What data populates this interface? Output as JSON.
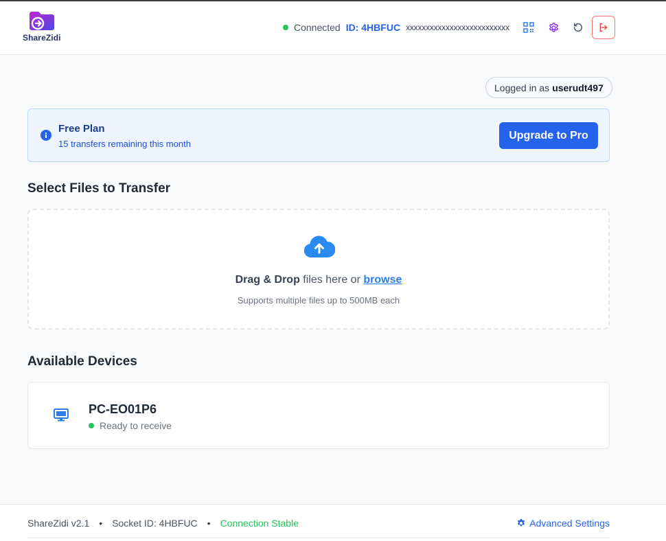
{
  "app": {
    "logo_text": "ShareZidi"
  },
  "header": {
    "status_text": "Connected",
    "id_label": "ID: 4HBFUC",
    "masked_value": "xxxxxxxxxxxxxxxxxxxxxxxxxx",
    "icons": [
      "qr-code-icon",
      "gear-icon",
      "refresh-icon",
      "logout-icon"
    ]
  },
  "user": {
    "logged_in_prefix": "Logged in as",
    "username": "userudt497"
  },
  "plan": {
    "title": "Free Plan",
    "subtitle": "15 transfers remaining this month",
    "upgrade_label": "Upgrade to Pro"
  },
  "files": {
    "section_title": "Select Files to Transfer",
    "drag_bold": "Drag & Drop",
    "drag_text": " files here or ",
    "browse_label": "browse",
    "hint": "Supports multiple files up to 500MB each"
  },
  "devices": {
    "section_title": "Available Devices",
    "items": [
      {
        "name": "PC-EO01P6",
        "status": "Ready to receive"
      }
    ]
  },
  "footer": {
    "version": "ShareZidi v2.1",
    "bullet": "•",
    "socket": "Socket ID: 4HBFUC",
    "connection": "Connection Stable",
    "advanced_label": "Advanced Settings"
  },
  "colors": {
    "accent": "#2563eb",
    "success": "#22c55e",
    "danger": "#f87171",
    "brand_purple": "#9333ea"
  }
}
